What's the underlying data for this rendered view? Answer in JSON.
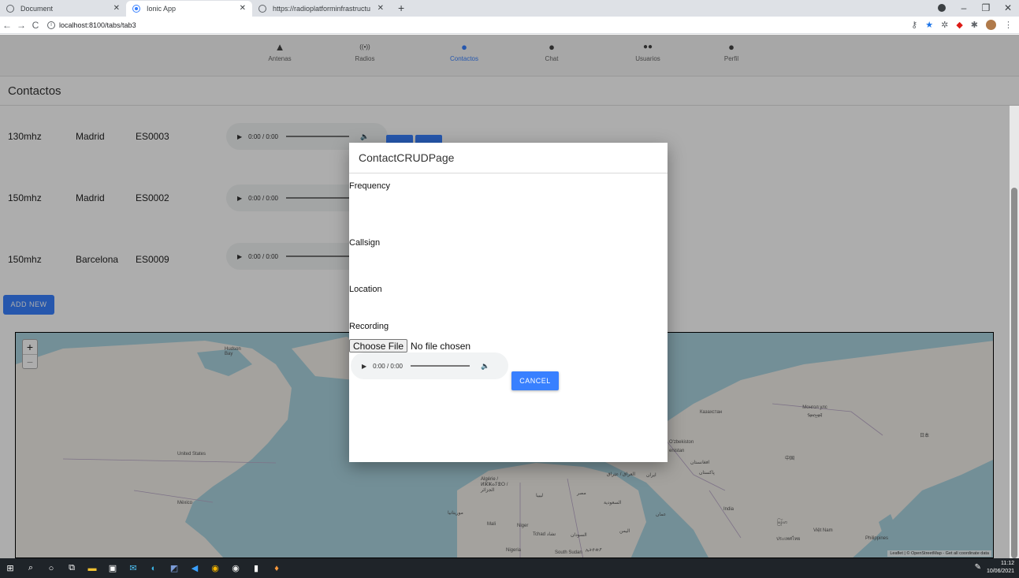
{
  "browser": {
    "tabs": [
      {
        "title": "Document",
        "active": false
      },
      {
        "title": "Ionic App",
        "active": true
      },
      {
        "title": "https://radioplatforminfrastructu",
        "active": false
      }
    ],
    "new_tab_glyph": "+",
    "url": "localhost:8100/tabs/tab3",
    "nav": {
      "back": "←",
      "forward": "→",
      "reload": "C"
    }
  },
  "app": {
    "nav_tabs": [
      {
        "label": "Antenas",
        "icon": "triangle-icon",
        "glyph": "▲"
      },
      {
        "label": "Radios",
        "icon": "radio-icon",
        "glyph": "((•))"
      },
      {
        "label": "Contactos",
        "icon": "person-icon",
        "glyph": "●",
        "active": true
      },
      {
        "label": "Chat",
        "icon": "chat-icon",
        "glyph": "●"
      },
      {
        "label": "Usuarios",
        "icon": "people-icon",
        "glyph": "●●"
      },
      {
        "label": "Perfil",
        "icon": "person-icon",
        "glyph": "●"
      }
    ],
    "page_title": "Contactos",
    "contacts": [
      {
        "frequency": "130mhz",
        "location": "Madrid",
        "callsign": "ES0003",
        "audio_time": "0:00 / 0:00"
      },
      {
        "frequency": "150mhz",
        "location": "Madrid",
        "callsign": "ES0002",
        "audio_time": "0:00 / 0:00"
      },
      {
        "frequency": "150mhz",
        "location": "Barcelona",
        "callsign": "ES0009",
        "audio_time": "0:00 / 0:00"
      }
    ],
    "add_new_label": "ADD NEW"
  },
  "map": {
    "zoom_in": "+",
    "zoom_out": "−",
    "labels": {
      "hudson": "Hudson Bay",
      "us": "United States",
      "mexico": "México",
      "algeria": "Algérie / ⵍⵣⵣⴰⵢⴻⵔ / الجزائر",
      "libya": "ليبيا",
      "egypt": "مصر",
      "mauritania": "موريتانيا",
      "mali": "Mali",
      "niger": "Niger",
      "chad": "Tchad تشاد",
      "sudan": "السودان",
      "nigeria": "Nigeria",
      "southsudan": "South Sudan",
      "ethiopia": "ኢትዮጵያ",
      "iraq": "العراق / عێراق",
      "iran": "ایران",
      "saudi": "السعودية",
      "yemen": "اليمن",
      "oman": "عمان",
      "kazakhstan": "Казахстан",
      "uzbekistan": "O'zbekiston",
      "turkmenistan": "enistan",
      "afghanistan": "افغانستان",
      "pakistan": "پاکستان",
      "india": "India",
      "mongolia": "Монгол улс ᠮᠣᠩᠭᠣᠯ",
      "china": "中国",
      "japan": "日本",
      "myanmar": "မြန်မာ",
      "vietnam": "Việt Nam",
      "thailand": "ประเทศไทย",
      "philippines": "Philippines"
    },
    "attribution": "Leaflet | © OpenStreetMap - Get all coordinate data"
  },
  "modal": {
    "title": "ContactCRUDPage",
    "frequency_label": "Frequency",
    "callsign_label": "Callsign",
    "location_label": "Location",
    "recording_label": "Recording",
    "choose_file_label": "Choose File",
    "no_file_text": "No file chosen",
    "audio_time": "0:00 / 0:00",
    "cancel_label": "CANCEL"
  },
  "taskbar": {
    "time": "11:12",
    "date": "10/06/2021"
  }
}
